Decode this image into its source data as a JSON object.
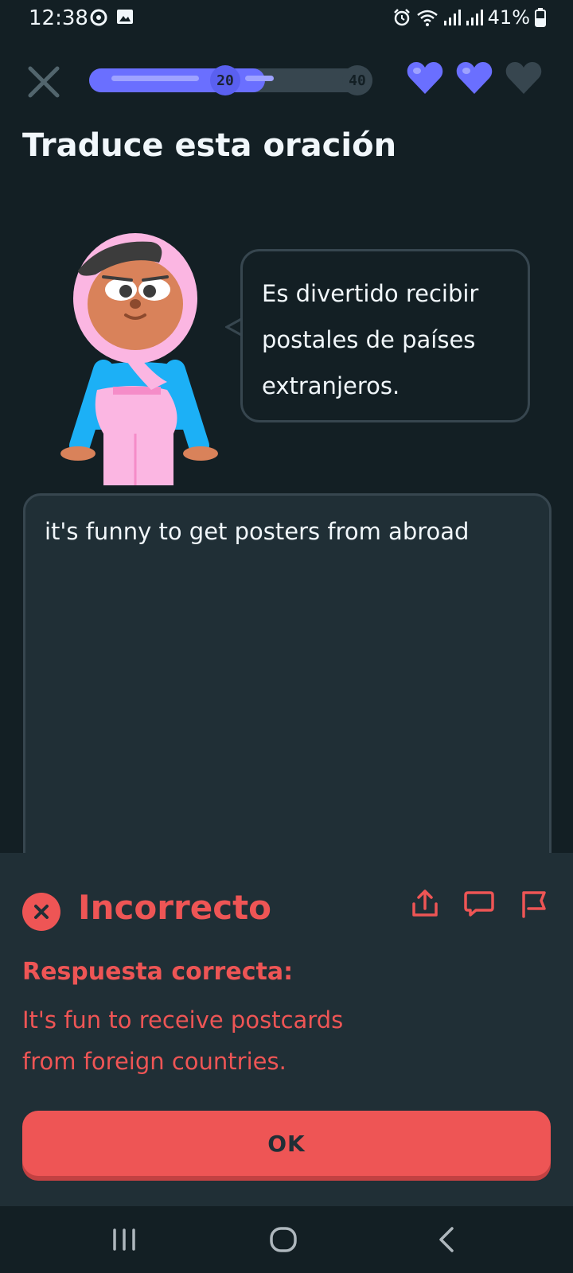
{
  "status_bar": {
    "time": "12:38",
    "battery": "41%"
  },
  "progress": {
    "fraction": 0.62,
    "milestone_1": "20",
    "milestone_2": "40"
  },
  "hearts": {
    "total": 3,
    "filled": 2
  },
  "title": "Traduce esta oración",
  "speech_bubble": {
    "line1": "Es divertido recibir",
    "line2": "postales de países",
    "line3": "extranjeros."
  },
  "answer_input": {
    "value": "it's funny to get posters from abroad"
  },
  "feedback": {
    "status": "Incorrecto",
    "label": "Respuesta correcta:",
    "correct_line1": "It's fun to receive postcards",
    "correct_line2": "from foreign countries.",
    "ok_label": "OK"
  },
  "colors": {
    "background": "#131f24",
    "accent_blue": "#6a6fff",
    "error_red": "#ee5555"
  }
}
